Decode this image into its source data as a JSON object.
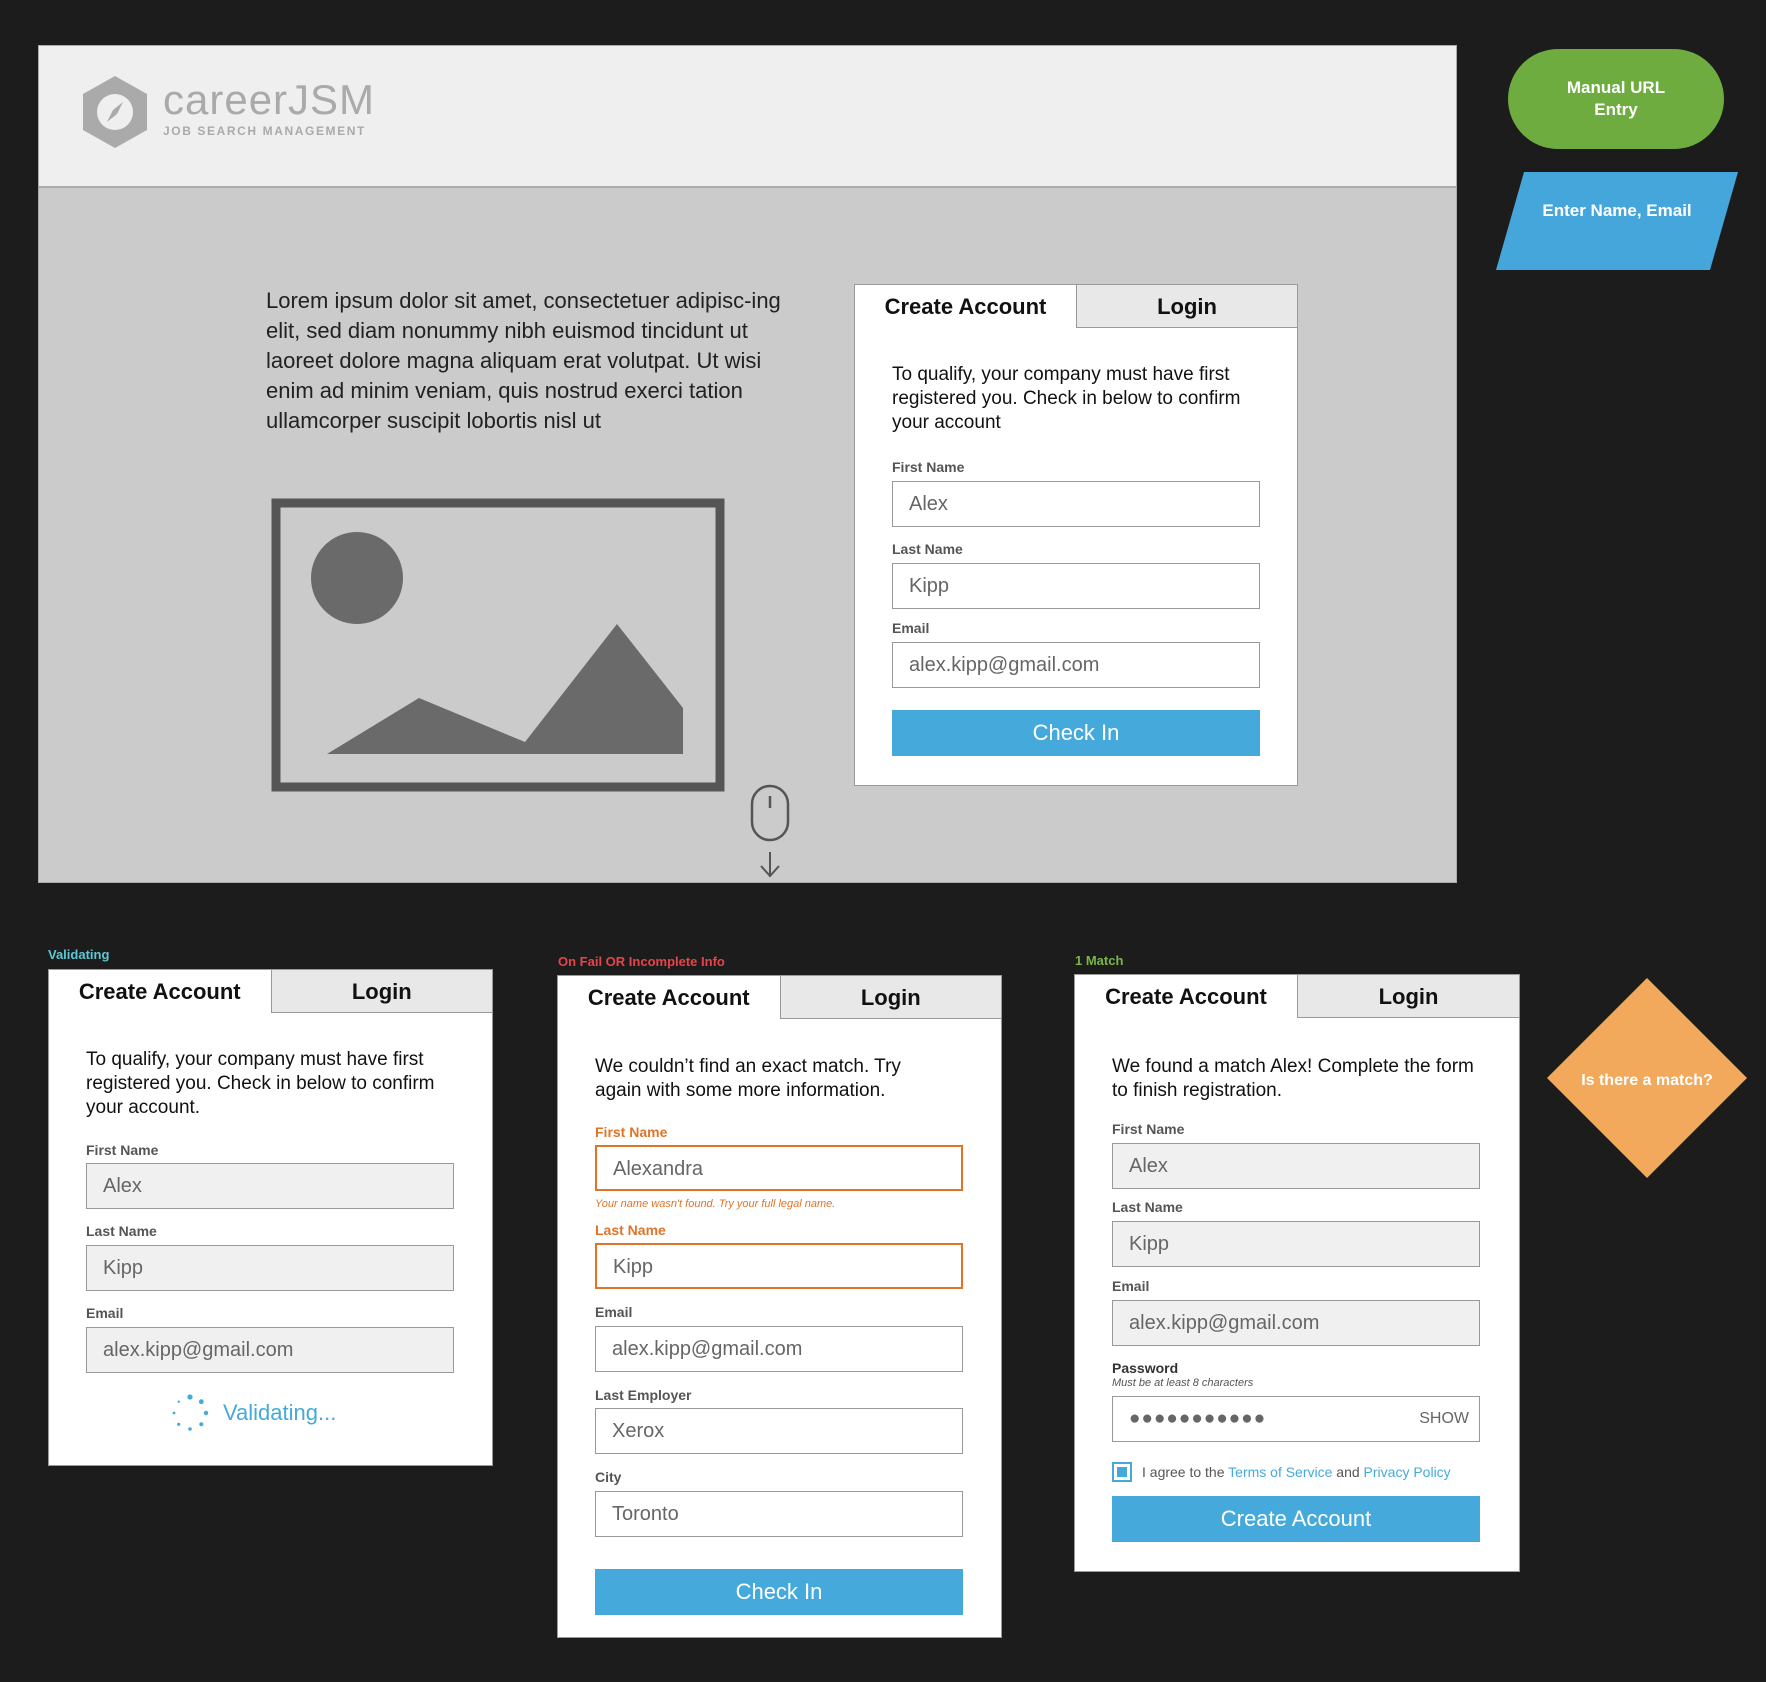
{
  "logo": {
    "word": "careerJSM",
    "tagline": "JOB SEARCH MANAGEMENT"
  },
  "lorem": "Lorem ipsum dolor sit amet, consectetuer adipisc-ing elit, sed diam nonummy nibh euismod tincidunt ut laoreet dolore magna aliquam erat volutpat. Ut wisi enim ad minim veniam, quis nostrud exerci tation ullamcorper suscipit lobortis nisl ut",
  "tabs": {
    "create": "Create Account",
    "login": "Login"
  },
  "fields": {
    "first_name": "First Name",
    "last_name": "Last Name",
    "email": "Email",
    "last_employer": "Last Employer",
    "city": "City",
    "password": "Password",
    "password_hint": "Must be at least 8 characters"
  },
  "main_form": {
    "intro": "To qualify, your company must have first registered you. Check in below to confirm your account",
    "first_name": "Alex",
    "last_name": "Kipp",
    "email": "alex.kipp@gmail.com",
    "button": "Check In"
  },
  "validating": {
    "label": "Validating",
    "intro": "To qualify, your company must have first registered you. Check in below to confirm your account.",
    "first_name": "Alex",
    "last_name": "Kipp",
    "email": "alex.kipp@gmail.com",
    "status": "Validating..."
  },
  "fail": {
    "label": "On Fail OR Incomplete Info",
    "intro": "We couldn’t find an exact match. Try again with some more information.",
    "first_name": "Alexandra",
    "error": "Your name wasn't found. Try your full legal name.",
    "last_name": "Kipp",
    "email": "alex.kipp@gmail.com",
    "last_employer": "Xerox",
    "city": "Toronto",
    "button": "Check In"
  },
  "match": {
    "label": "1 Match",
    "intro": "We found a match Alex! Complete the form to finish registration.",
    "first_name": "Alex",
    "last_name": "Kipp",
    "email": "alex.kipp@gmail.com",
    "password_mask": "●●●●●●●●●●●",
    "show": "SHOW",
    "agree_prefix": "I agree to the",
    "terms": "Terms of Service",
    "and": "and",
    "privacy": "Privacy Policy",
    "button": "Create Account"
  },
  "flowchart": {
    "manual": "Manual URL Entry",
    "enter": "Enter Name, Email",
    "decision": "Is there a match?"
  },
  "colors": {
    "accent": "#45aadb",
    "error": "#e07428",
    "validating": "#5bc8d6",
    "fail": "#e8434b",
    "match": "#7ab648",
    "green_node": "#6fac3f",
    "blue_node": "#45a6dc",
    "orange_node": "#f2a95b"
  }
}
